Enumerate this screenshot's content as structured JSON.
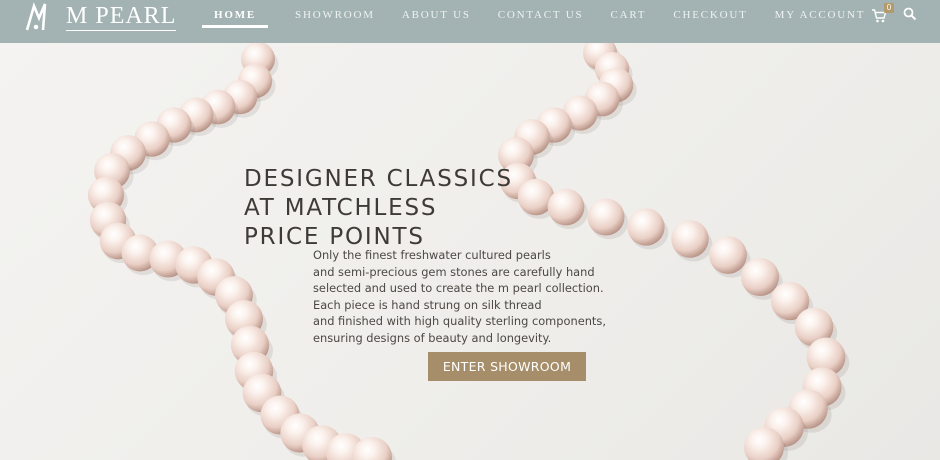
{
  "header": {
    "brand": "M PEARL",
    "nav": [
      {
        "label": "HOME"
      },
      {
        "label": "SHOWROOM"
      },
      {
        "label": "ABOUT US"
      },
      {
        "label": "CONTACT US"
      },
      {
        "label": "CART"
      },
      {
        "label": "CHECKOUT"
      },
      {
        "label": "MY ACCOUNT"
      }
    ],
    "cart_count": "0",
    "icons": [
      "logo-mark-icon",
      "cart-icon",
      "search-icon"
    ]
  },
  "hero": {
    "headline": [
      "DESIGNER CLASSICS",
      "AT MATCHLESS",
      "PRICE POINTS"
    ],
    "body": [
      "Only the finest freshwater cultured pearls",
      "and semi-precious gem stones are carefully hand",
      "selected and used to create the m pearl collection.",
      "Each piece is hand strung on silk thread",
      "and finished with high quality sterling components,",
      "ensuring designs of beauty and longevity."
    ],
    "cta_label": "ENTER SHOWROOM",
    "image": "pearl-necklace-image"
  },
  "colors": {
    "header_bg": "#a3b2b2",
    "cta_bg": "#a68e6a",
    "badge_bg": "#b39a6a",
    "headline_text": "#3e3a36"
  }
}
